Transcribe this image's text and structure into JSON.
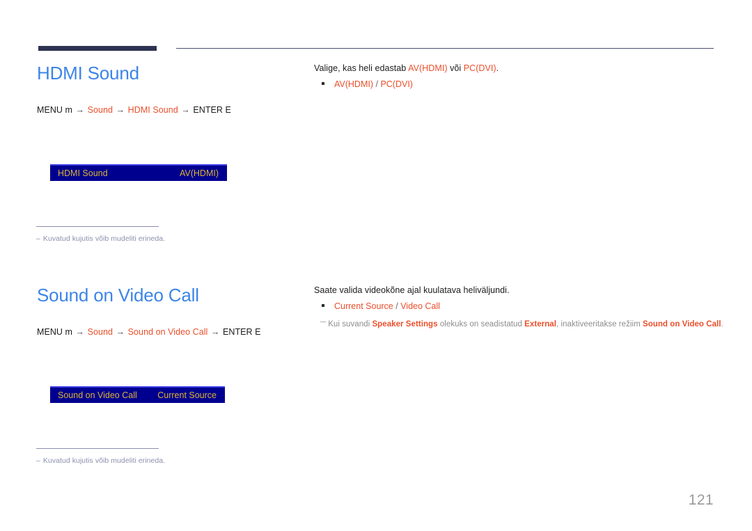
{
  "page": {
    "number": "121"
  },
  "sections": [
    {
      "title": "HDMI Sound",
      "menu_path": {
        "menu_label": "MENU",
        "menu_key": "m",
        "arrow": "→",
        "step1": "Sound",
        "step2": "HDMI Sound",
        "enter_label": "ENTER",
        "enter_key": "E"
      },
      "osd": {
        "label": "HDMI Sound",
        "value": "AV(HDMI)"
      },
      "footnote": {
        "dash": "–",
        "text": "Kuvatud kujutis võib mudeliti erineda."
      },
      "description": {
        "prefix": "Valige, kas heli edastab ",
        "option1": "AV(HDMI)",
        "middle": " või ",
        "option2": "PC(DVI)",
        "suffix": "."
      },
      "bullet": {
        "first": "AV(HDMI)",
        "separator": " / ",
        "second": "PC(DVI)"
      },
      "note": null
    },
    {
      "title": "Sound on Video Call",
      "menu_path": {
        "menu_label": "MENU",
        "menu_key": "m",
        "arrow": "→",
        "step1": "Sound",
        "step2": "Sound on Video Call",
        "enter_label": "ENTER",
        "enter_key": "E"
      },
      "osd": {
        "label": "Sound on Video Call",
        "value": "Current Source"
      },
      "footnote": {
        "dash": "–",
        "text": "Kuvatud kujutis võib mudeliti erineda."
      },
      "description": {
        "prefix": "Saate valida videokõne ajal kuulatava heliväljundi.",
        "option1": "",
        "middle": "",
        "option2": "",
        "suffix": ""
      },
      "bullet": {
        "first": "Current Source",
        "separator": " / ",
        "second": "Video Call"
      },
      "note": {
        "dash": "─",
        "part1": "Kui suvandi ",
        "bold1": "Speaker Settings",
        "part2": " olekuks on seadistatud ",
        "bold2": "External",
        "part3": ", inaktiveeritakse režiim ",
        "bold3": "Sound on Video Call",
        "part4": "."
      }
    }
  ],
  "colors": {
    "heading_blue": "#3d85e8",
    "accent_orange": "#ea4f2b",
    "osd_background": "#00008f",
    "osd_text": "#ddb430",
    "header_bar": "#2e3351",
    "footnote_gray": "#8b8fad",
    "note_gray": "#8c8c8c",
    "page_number_gray": "#9b9b9b"
  }
}
